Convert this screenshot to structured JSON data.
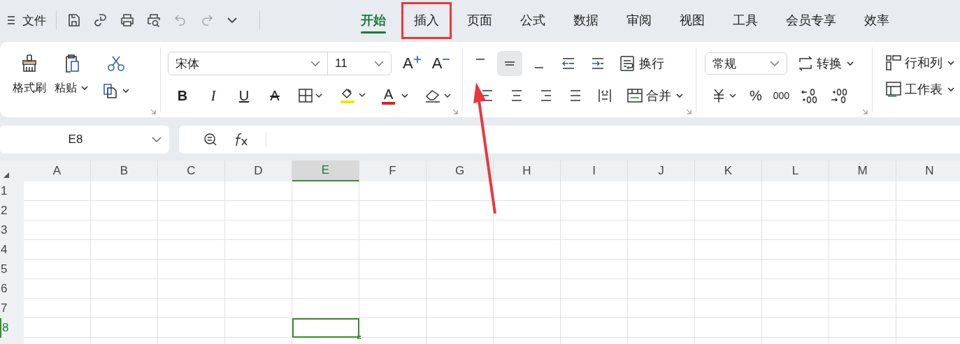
{
  "menu": {
    "file": "文件"
  },
  "tabs": [
    {
      "label": "开始",
      "selected": true,
      "highlighted": false
    },
    {
      "label": "插入",
      "selected": false,
      "highlighted": true
    },
    {
      "label": "页面",
      "selected": false,
      "highlighted": false
    },
    {
      "label": "公式",
      "selected": false,
      "highlighted": false
    },
    {
      "label": "数据",
      "selected": false,
      "highlighted": false
    },
    {
      "label": "审阅",
      "selected": false,
      "highlighted": false
    },
    {
      "label": "视图",
      "selected": false,
      "highlighted": false
    },
    {
      "label": "工具",
      "selected": false,
      "highlighted": false
    },
    {
      "label": "会员专享",
      "selected": false,
      "highlighted": false
    },
    {
      "label": "效率",
      "selected": false,
      "highlighted": false
    }
  ],
  "ribbon": {
    "clipboard": {
      "format_painter": "格式刷",
      "paste": "粘贴"
    },
    "font": {
      "family": "宋体",
      "size": "11",
      "grow": "A",
      "shrink": "A",
      "bold": "B",
      "italic": "I",
      "underline": "U",
      "strikethrough": "A",
      "font_color": "A"
    },
    "alignment": {
      "vertical": [
        {
          "kind": "top",
          "selected": false
        },
        {
          "kind": "middle",
          "selected": true
        },
        {
          "kind": "bottom",
          "selected": false
        }
      ],
      "wrap": "换行",
      "merge": "合并"
    },
    "number": {
      "format": "常规",
      "convert": "转换",
      "percent": "%",
      "thousands": "000"
    },
    "cells": {
      "rows_columns": "行和列",
      "worksheet": "工作表"
    }
  },
  "formula_bar": {
    "name_box": "E8"
  },
  "sheet": {
    "columns": [
      {
        "label": "A",
        "selected": false
      },
      {
        "label": "B",
        "selected": false
      },
      {
        "label": "C",
        "selected": false
      },
      {
        "label": "D",
        "selected": false
      },
      {
        "label": "E",
        "selected": true
      },
      {
        "label": "F",
        "selected": false
      },
      {
        "label": "G",
        "selected": false
      },
      {
        "label": "H",
        "selected": false
      },
      {
        "label": "I",
        "selected": false
      },
      {
        "label": "J",
        "selected": false
      },
      {
        "label": "K",
        "selected": false
      },
      {
        "label": "L",
        "selected": false
      },
      {
        "label": "M",
        "selected": false
      },
      {
        "label": "N",
        "selected": false
      }
    ],
    "rows": [
      {
        "label": "1",
        "selected": false
      },
      {
        "label": "2",
        "selected": false
      },
      {
        "label": "3",
        "selected": false
      },
      {
        "label": "4",
        "selected": false
      },
      {
        "label": "5",
        "selected": false
      },
      {
        "label": "6",
        "selected": false
      },
      {
        "label": "7",
        "selected": false
      },
      {
        "label": "8",
        "selected": true
      }
    ]
  }
}
